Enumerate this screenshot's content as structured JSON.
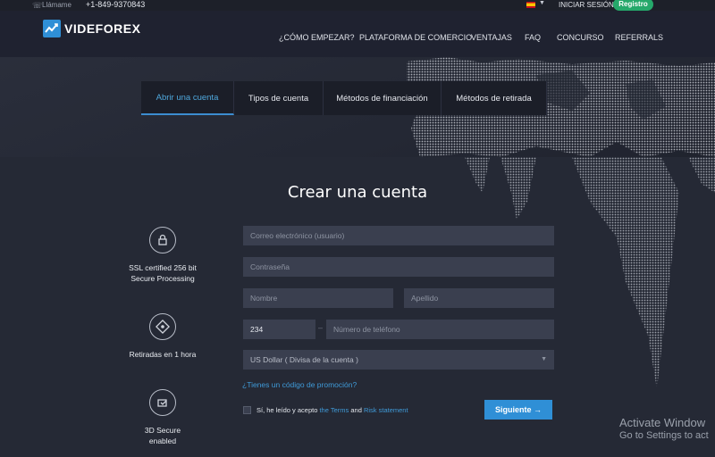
{
  "topbar": {
    "call_label": "Llámame",
    "phone": "+1-849-9370843",
    "login": "INICIAR SESIÓN",
    "register": "Registro"
  },
  "header": {
    "logo_text": "VIDEFOREX",
    "nav": [
      "¿CÓMO EMPEZAR?",
      "PLATAFORMA DE COMERCIO",
      "VENTAJAS",
      "FAQ",
      "CONCURSO",
      "REFERRALS"
    ]
  },
  "tabs": [
    "Abrir una cuenta",
    "Tipos de cuenta",
    "Métodos de financiación",
    "Métodos de retirada"
  ],
  "page_title": "Crear una cuenta",
  "features": [
    {
      "icon": "lock-icon",
      "line1": "SSL certified 256 bit",
      "line2": "Secure Processing"
    },
    {
      "icon": "withdraw-icon",
      "line1": "Retiradas en 1 hora",
      "line2": ""
    },
    {
      "icon": "3d-secure-icon",
      "line1": "3D Secure",
      "line2": "enabled"
    }
  ],
  "form": {
    "email_placeholder": "Correo electrónico (usuario)",
    "password_placeholder": "Contraseña",
    "first_name_placeholder": "Nombre",
    "last_name_placeholder": "Apellido",
    "country_code": "234",
    "phone_placeholder": "Número de teléfono",
    "currency": "US Dollar ( Divisa de la cuenta )",
    "promo_link": "¿Tienes un código de promoción?",
    "terms_prefix": "Sí, he leído y acepto ",
    "terms_link": "the Terms",
    "terms_and": " and ",
    "risk_link": "Risk statement",
    "submit": "Siguiente →"
  },
  "watermark": {
    "line1": "Activate Window",
    "line2": "Go to Settings to act"
  },
  "colors": {
    "accent": "#2f8fd6",
    "register": "#25a86a",
    "background": "#252935"
  }
}
